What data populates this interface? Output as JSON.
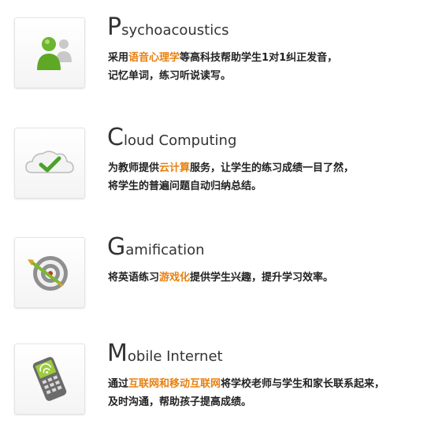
{
  "features": [
    {
      "icon": "users-icon",
      "title_initial": "P",
      "title_rest": "sychoacoustics",
      "desc_before": "采用",
      "desc_highlight": "语音心理学",
      "desc_after": "等高科技帮助学生1对1纠正发音，",
      "desc_line2": "记忆单词，练习听说读写。"
    },
    {
      "icon": "cloud-check-icon",
      "title_initial": "C",
      "title_rest": "loud Computing",
      "desc_before": "为教师提供",
      "desc_highlight": "云计算",
      "desc_after": "服务，让学生的练习成绩一目了然，",
      "desc_line2": "将学生的普遍问题自动归纳总结。"
    },
    {
      "icon": "target-arrow-icon",
      "title_initial": "G",
      "title_rest": "amification",
      "desc_before": "将英语练习",
      "desc_highlight": "游戏化",
      "desc_after": "提供学生兴趣，提升学习效率。",
      "desc_line2": ""
    },
    {
      "icon": "mobile-phone-icon",
      "title_initial": "M",
      "title_rest": "obile Internet",
      "desc_before": "通过",
      "desc_highlight": "互联网和移动互联网",
      "desc_after": "将学校老师与学生和家长联系起来，",
      "desc_line2": "及时沟通，帮助孩子提高成绩。"
    }
  ],
  "colors": {
    "highlight": "#e8800f",
    "text": "#222222",
    "title": "#333333"
  }
}
